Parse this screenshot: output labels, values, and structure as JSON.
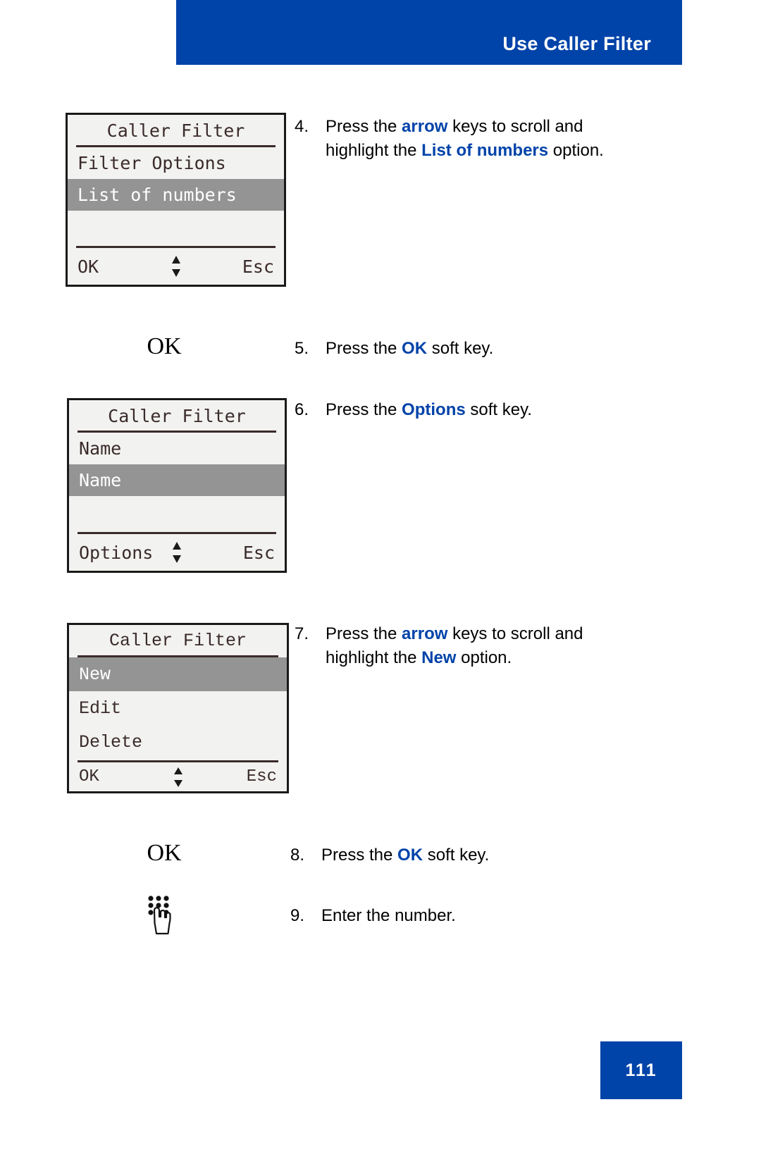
{
  "header": {
    "title": "Use Caller Filter",
    "band_color": "#0043a9"
  },
  "footer": {
    "page_number": "111",
    "band_color": "#0043a9"
  },
  "accent_color": "#0043a9",
  "screens": [
    {
      "id": "caller-filter-list-of-numbers",
      "title": "Caller Filter",
      "items": [
        {
          "label": "Filter Options",
          "selected": false
        },
        {
          "label": "List of numbers",
          "selected": true
        }
      ],
      "softkeys": {
        "left": "OK",
        "center_icon": "up-down-arrows",
        "right": "Esc"
      }
    },
    {
      "id": "caller-filter-names",
      "title": "Caller Filter",
      "items": [
        {
          "label": "Name",
          "selected": false
        },
        {
          "label": "Name",
          "selected": true
        }
      ],
      "softkeys": {
        "left": "Options",
        "center_icon": "up-down-arrows",
        "right": "Esc"
      }
    },
    {
      "id": "caller-filter-new-edit-delete",
      "title": "Caller Filter",
      "items": [
        {
          "label": "New",
          "selected": true
        },
        {
          "label": "Edit",
          "selected": false
        },
        {
          "label": "Delete",
          "selected": false
        }
      ],
      "softkeys": {
        "left": "OK",
        "center_icon": "up-down-arrows",
        "right": "Esc"
      }
    }
  ],
  "steps": [
    {
      "number": "4.",
      "icon": "",
      "parts": [
        {
          "t": "Press the ",
          "b": false
        },
        {
          "t": "arrow",
          "b": true
        },
        {
          "t": " keys to scroll and highlight the ",
          "b": false
        },
        {
          "t": "List of numbers",
          "b": true
        },
        {
          "t": " option.",
          "b": false
        }
      ]
    },
    {
      "number": "5.",
      "icon": "OK",
      "parts": [
        {
          "t": "Press the ",
          "b": false
        },
        {
          "t": "OK",
          "b": true
        },
        {
          "t": " soft key.",
          "b": false
        }
      ]
    },
    {
      "number": "6.",
      "icon": "",
      "parts": [
        {
          "t": "Press the ",
          "b": false
        },
        {
          "t": "Options",
          "b": true
        },
        {
          "t": " soft key.",
          "b": false
        }
      ]
    },
    {
      "number": "7.",
      "icon": "",
      "parts": [
        {
          "t": "Press the ",
          "b": false
        },
        {
          "t": "arrow",
          "b": true
        },
        {
          "t": " keys to scroll and highlight the ",
          "b": false
        },
        {
          "t": "New",
          "b": true
        },
        {
          "t": " option.",
          "b": false
        }
      ]
    },
    {
      "number": "8.",
      "icon": "OK",
      "parts": [
        {
          "t": "Press the ",
          "b": false
        },
        {
          "t": "OK",
          "b": true
        },
        {
          "t": " soft key.",
          "b": false
        }
      ]
    },
    {
      "number": "9.",
      "icon": "keypad-hand",
      "parts": [
        {
          "t": "Enter the number.",
          "b": false
        }
      ]
    }
  ],
  "icons": {
    "ok_key_label": "OK",
    "keypad_hand_name": "keypad-hand-icon",
    "scroll_arrows_name": "up-down-arrows-icon"
  }
}
